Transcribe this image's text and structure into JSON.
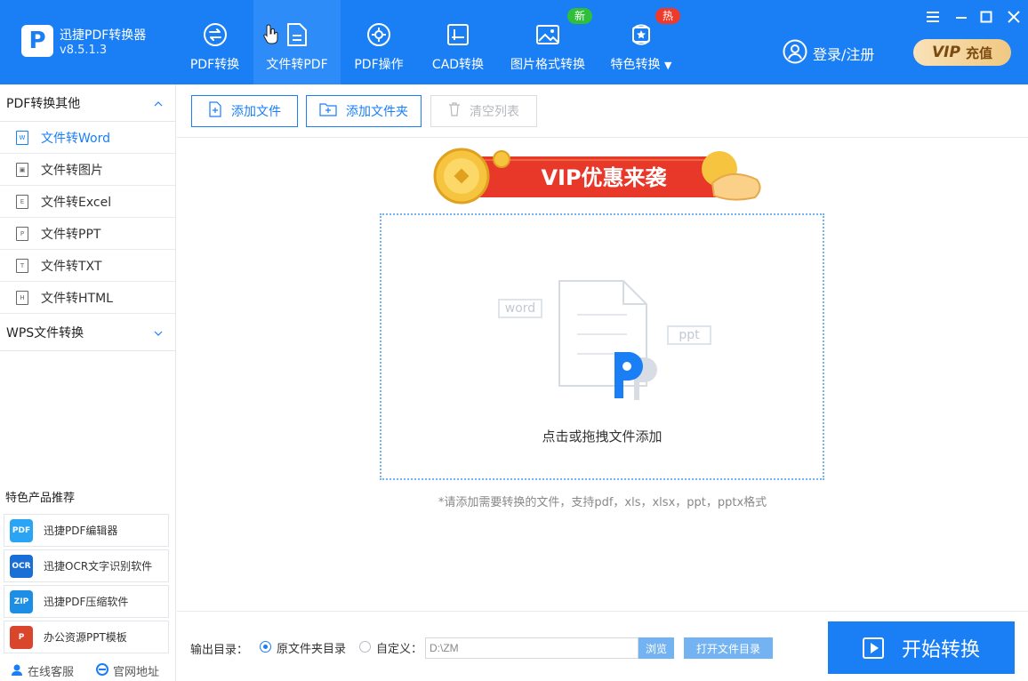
{
  "app": {
    "title": "迅捷PDF转换器",
    "version": "v8.5.1.3",
    "logo_letter": "P"
  },
  "nav": {
    "tabs": [
      {
        "label": "PDF转换",
        "icon": "swap-circle-icon"
      },
      {
        "label": "文件转PDF",
        "icon": "document-icon",
        "active": true
      },
      {
        "label": "PDF操作",
        "icon": "gear-circle-icon"
      },
      {
        "label": "CAD转换",
        "icon": "cad-icon"
      },
      {
        "label": "图片格式转换",
        "icon": "image-icon",
        "badge": "新"
      },
      {
        "label": "特色转换",
        "icon": "star-refresh-icon",
        "badge": "热",
        "dropdown": "▼"
      }
    ]
  },
  "header": {
    "login": "登录/注册",
    "vip_word": "VIP",
    "vip_text": "充值"
  },
  "window": {
    "menu": "☰",
    "minimize": "—",
    "maximize": "☐",
    "close": "✕"
  },
  "sidebar": {
    "section1": {
      "label": "PDF转换其他",
      "chevron": "︿"
    },
    "items": [
      {
        "label": "文件转Word",
        "tag": "W",
        "active": true
      },
      {
        "label": "文件转图片",
        "tag": "▣"
      },
      {
        "label": "文件转Excel",
        "tag": "E"
      },
      {
        "label": "文件转PPT",
        "tag": "P"
      },
      {
        "label": "文件转TXT",
        "tag": "T"
      },
      {
        "label": "文件转HTML",
        "tag": "H"
      }
    ],
    "section2": {
      "label": "WPS文件转换",
      "chevron": "﹀"
    },
    "recommend_title": "特色产品推荐",
    "recommend": [
      {
        "label": "迅捷PDF编辑器",
        "icon_text": "PDF",
        "color": "#2aa4f4"
      },
      {
        "label": "迅捷OCR文字识别软件",
        "icon_text": "OCR",
        "color": "#1a6fd6"
      },
      {
        "label": "迅捷PDF压缩软件",
        "icon_text": "ZIP",
        "color": "#1c8ee6"
      },
      {
        "label": "办公资源PPT模板",
        "icon_text": "P",
        "color": "#d9462b"
      }
    ],
    "footer": {
      "service": "在线客服",
      "website": "官网地址"
    }
  },
  "toolbar": {
    "add_file": "添加文件",
    "add_folder": "添加文件夹",
    "clear": "清空列表"
  },
  "main": {
    "banner": "VIP优惠来袭",
    "drop_text": "点击或拖拽文件添加",
    "tag_word": "word",
    "tag_ppt": "ppt",
    "hint": "*请添加需要转换的文件，支持pdf，xls，xlsx，ppt，pptx格式"
  },
  "bottom": {
    "output_label": "输出目录：",
    "option_original": "原文件夹目录",
    "option_custom": "自定义：",
    "path_value": "D:\\ZM",
    "browse": "浏览",
    "open_dir": "打开文件目录",
    "start": "开始转换"
  },
  "colors": {
    "primary": "#1a7ff5",
    "active_tab": "#2d8cf8",
    "new_badge": "#2fbf3b",
    "hot_badge": "#ef3a2b"
  }
}
